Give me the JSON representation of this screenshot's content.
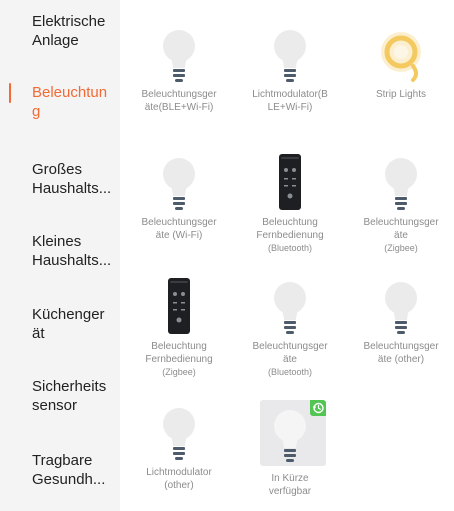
{
  "sidebar": {
    "items": [
      {
        "label": "Elektrische\nAnlage",
        "active": false
      },
      {
        "label": "Beleuchtun\ng",
        "active": true
      },
      {
        "label": "Großes\nHaushalts...",
        "active": false
      },
      {
        "label": "Kleines\nHaushalts...",
        "active": false
      },
      {
        "label": "Küchenger\nät",
        "active": false
      },
      {
        "label": "Sicherheits\nsensor",
        "active": false
      },
      {
        "label": "Tragbare\nGesundh...",
        "active": false
      }
    ]
  },
  "devices": [
    {
      "icon": "bulb-icon",
      "label": "Beleuchtungsger\näte(BLE+Wi-Fi)",
      "sub": ""
    },
    {
      "icon": "bulb-icon",
      "label": "Lichtmodulator(B\nLE+Wi-Fi)",
      "sub": ""
    },
    {
      "icon": "strip-lights-icon",
      "label": "Strip Lights",
      "sub": ""
    },
    {
      "icon": "bulb-icon",
      "label": "Beleuchtungsger\näte (Wi-Fi)",
      "sub": ""
    },
    {
      "icon": "remote-control-icon",
      "label": "Beleuchtung\nFernbedienung",
      "sub": "(Bluetooth)"
    },
    {
      "icon": "bulb-icon",
      "label": "Beleuchtungsger\näte",
      "sub": "(Zigbee)"
    },
    {
      "icon": "remote-control-icon",
      "label": "Beleuchtung\nFernbedienung",
      "sub": "(Zigbee)"
    },
    {
      "icon": "bulb-icon",
      "label": "Beleuchtungsger\näte",
      "sub": "(Bluetooth)"
    },
    {
      "icon": "bulb-icon",
      "label": "Beleuchtungsger\näte (other)",
      "sub": ""
    },
    {
      "icon": "bulb-icon",
      "label": "Lichtmodulator\n(other)",
      "sub": ""
    },
    {
      "icon": "bulb-icon",
      "label": "In Kürze\nverfügbar",
      "sub": "",
      "badge": "history-icon"
    }
  ],
  "colors": {
    "accent": "#f26a35",
    "sidebar_bg": "#f4f4f5",
    "label_gray": "#8c8c8c",
    "badge_green": "#53c553",
    "strip_light": "#f3c960"
  }
}
